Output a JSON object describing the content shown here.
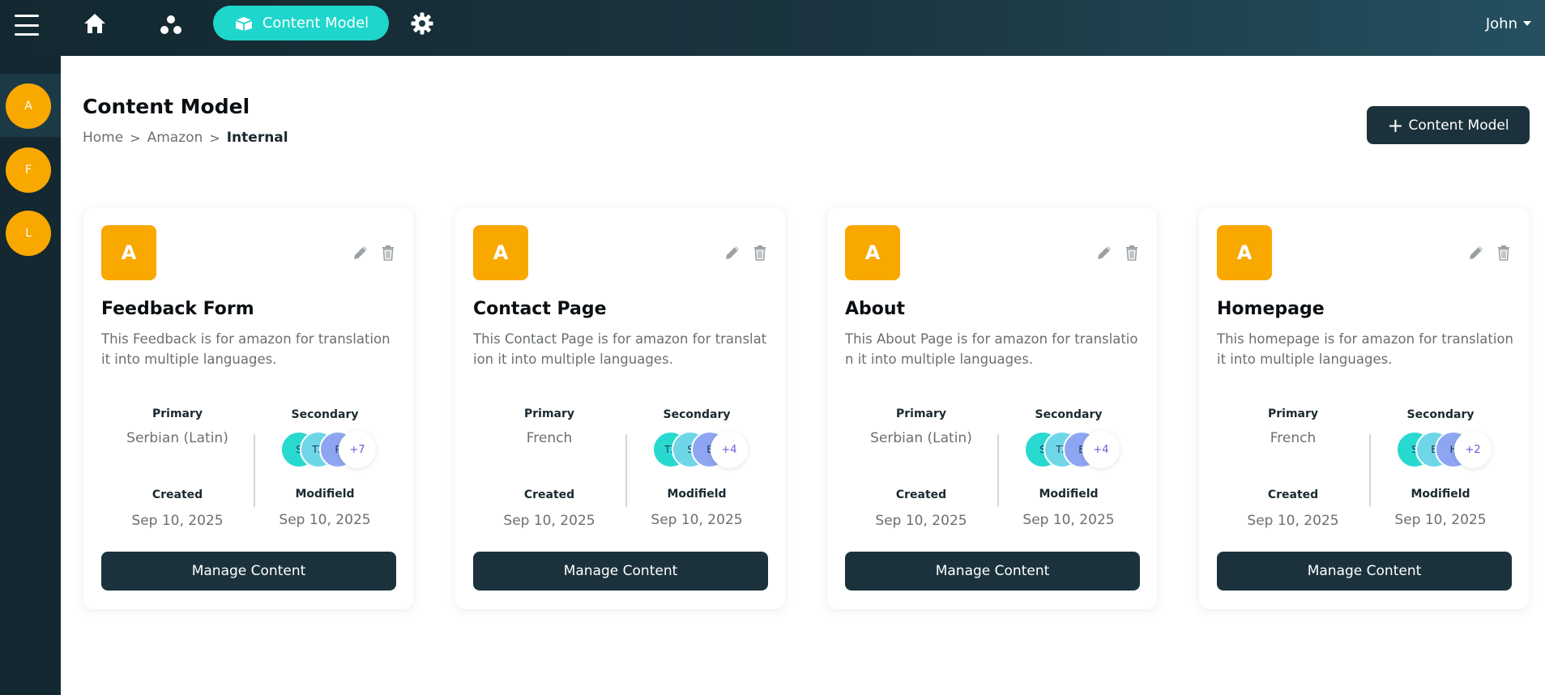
{
  "topbar": {
    "content_model_label": "Content Model",
    "user_name": "John"
  },
  "sidebar": {
    "avatars": [
      "A",
      "F",
      "L"
    ]
  },
  "header": {
    "title": "Content Model",
    "breadcrumb": [
      "Home",
      "Amazon",
      "Internal"
    ],
    "add_button_label": "Content Model"
  },
  "labels": {
    "primary": "Primary",
    "secondary": "Secondary",
    "created": "Created",
    "modified": "Modifield",
    "manage": "Manage Content"
  },
  "cards": [
    {
      "badge": "A",
      "title": "Feedback Form",
      "description": "This Feedback is for amazon for translation it into multiple languages.",
      "primary": "Serbian (Latin)",
      "secondary": [
        "S",
        "TZ",
        "P"
      ],
      "secondary_more": "+7",
      "created": "Sep 10, 2025",
      "modified": "Sep 10, 2025"
    },
    {
      "badge": "A",
      "title": "Contact Page",
      "description": "This Contact Page is for amazon for translation it into multiple languages.",
      "primary": "French",
      "secondary": [
        "TZ",
        "S",
        "E"
      ],
      "secondary_more": "+4",
      "created": "Sep 10, 2025",
      "modified": "Sep 10, 2025"
    },
    {
      "badge": "A",
      "title": "About",
      "description": "This About Page is for amazon for translation it into multiple languages.",
      "primary": "Serbian (Latin)",
      "secondary": [
        "S",
        "TZ",
        "E"
      ],
      "secondary_more": "+4",
      "created": "Sep 10, 2025",
      "modified": "Sep 10, 2025"
    },
    {
      "badge": "A",
      "title": "Homepage",
      "description": "This homepage is for amazon for translation it into multiple languages.",
      "primary": "French",
      "secondary": [
        "S",
        "E",
        "H"
      ],
      "secondary_more": "+2",
      "created": "Sep 10, 2025",
      "modified": "Sep 10, 2025"
    }
  ],
  "colors": {
    "accent": "#1ed6cb",
    "badge": "#f9a800",
    "dark": "#1b323c",
    "mini_avatars": [
      "#28d9cf",
      "#6fd6e8",
      "#8ea6f2"
    ]
  }
}
